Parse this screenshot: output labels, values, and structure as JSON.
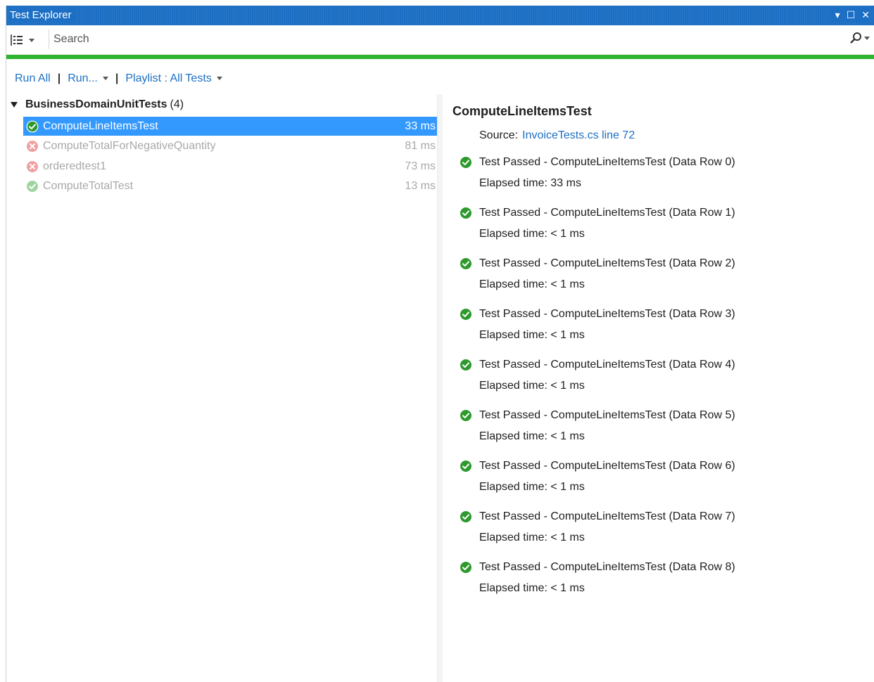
{
  "window": {
    "title": "Test Explorer",
    "controls": [
      "▾",
      "☐",
      "✕"
    ]
  },
  "toolbar": {
    "search_placeholder": "Search"
  },
  "runbar": {
    "run_all": "Run All",
    "run": "Run...",
    "playlist": "Playlist : All Tests"
  },
  "group": {
    "name": "BusinessDomainUnitTests",
    "count": "(4)"
  },
  "tests": [
    {
      "name": "ComputeLineItemsTest",
      "time": "33 ms",
      "status": "passed",
      "selected": true
    },
    {
      "name": "ComputeTotalForNegativeQuantity",
      "time": "81 ms",
      "status": "failed",
      "selected": false
    },
    {
      "name": "orderedtest1",
      "time": "73 ms",
      "status": "failed",
      "selected": false
    },
    {
      "name": "ComputeTotalTest",
      "time": "13 ms",
      "status": "passed",
      "selected": false
    }
  ],
  "detail": {
    "title": "ComputeLineItemsTest",
    "source_label": "Source:",
    "source_link": "InvoiceTests.cs line 72",
    "results": [
      {
        "text": "Test Passed - ComputeLineItemsTest (Data Row 0)",
        "elapsed": "Elapsed time: 33 ms"
      },
      {
        "text": "Test Passed - ComputeLineItemsTest (Data Row 1)",
        "elapsed": "Elapsed time: < 1 ms"
      },
      {
        "text": "Test Passed - ComputeLineItemsTest (Data Row 2)",
        "elapsed": "Elapsed time: < 1 ms"
      },
      {
        "text": "Test Passed - ComputeLineItemsTest (Data Row 3)",
        "elapsed": "Elapsed time: < 1 ms"
      },
      {
        "text": "Test Passed - ComputeLineItemsTest (Data Row 4)",
        "elapsed": "Elapsed time: < 1 ms"
      },
      {
        "text": "Test Passed - ComputeLineItemsTest (Data Row 5)",
        "elapsed": "Elapsed time: < 1 ms"
      },
      {
        "text": "Test Passed - ComputeLineItemsTest (Data Row 6)",
        "elapsed": "Elapsed time: < 1 ms"
      },
      {
        "text": "Test Passed - ComputeLineItemsTest (Data Row 7)",
        "elapsed": "Elapsed time: < 1 ms"
      },
      {
        "text": "Test Passed - ComputeLineItemsTest (Data Row 8)",
        "elapsed": "Elapsed time: < 1 ms"
      }
    ]
  },
  "colors": {
    "titlebar": "#1c6fc4",
    "progress": "#2fb42f",
    "selection": "#3399ff",
    "pass": "#2e9a2e",
    "fail": "#e05050",
    "link": "#1c6fc4"
  },
  "icons": {
    "group_by": "group-by-icon",
    "search": "search-icon",
    "pass": "check-circle-icon",
    "fail": "x-circle-icon"
  }
}
